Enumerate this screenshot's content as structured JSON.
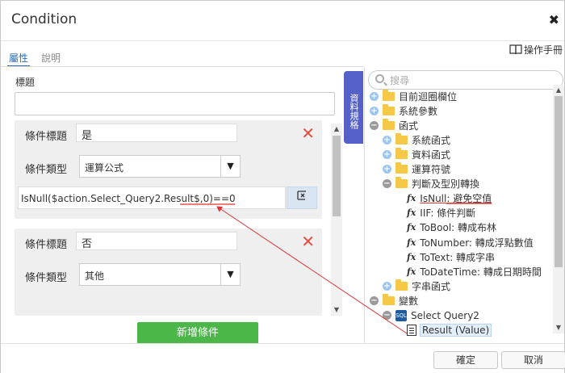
{
  "window": {
    "title": "Condition",
    "close": "✖"
  },
  "manual": {
    "label": "操作手冊"
  },
  "tabs": [
    {
      "label": "屬性",
      "active": true
    },
    {
      "label": "說明",
      "active": false
    }
  ],
  "left": {
    "title_label": "標題",
    "title_value": "",
    "conditions": [
      {
        "title_label": "條件標題",
        "title_value": "是",
        "type_label": "條件類型",
        "type_value": "運算公式",
        "formula": "IsNull($action.Select_Query2.Result$,0)==0",
        "formula_btn_icon": "function-editor-icon"
      },
      {
        "title_label": "條件標題",
        "title_value": "否",
        "type_label": "條件類型",
        "type_value": "其他"
      }
    ],
    "add_button": "新增條件"
  },
  "side_tab": {
    "label": "資料規格"
  },
  "search": {
    "placeholder": "搜尋"
  },
  "tree": [
    {
      "label": "目前迴圈欄位",
      "toggle": "+",
      "icon": "folder",
      "depth": 0
    },
    {
      "label": "系統參數",
      "toggle": "+",
      "icon": "folder",
      "depth": 0
    },
    {
      "label": "函式",
      "toggle": "−",
      "icon": "folder",
      "depth": 0
    },
    {
      "label": "系統函式",
      "toggle": "+",
      "icon": "folder",
      "depth": 1
    },
    {
      "label": "資料函式",
      "toggle": "+",
      "icon": "folder",
      "depth": 1
    },
    {
      "label": "運算符號",
      "toggle": "+",
      "icon": "folder",
      "depth": 1
    },
    {
      "label": "判斷及型別轉換",
      "toggle": "−",
      "icon": "folder",
      "depth": 1
    },
    {
      "label": "IsNull: 避免空值",
      "toggle": "",
      "icon": "fx",
      "depth": 2,
      "highlight": true
    },
    {
      "label": "IIF: 條件判斷",
      "toggle": "",
      "icon": "fx",
      "depth": 2
    },
    {
      "label": "ToBool: 轉成布林",
      "toggle": "",
      "icon": "fx",
      "depth": 2
    },
    {
      "label": "ToNumber: 轉成浮點數值",
      "toggle": "",
      "icon": "fx",
      "depth": 2
    },
    {
      "label": "ToText: 轉成字串",
      "toggle": "",
      "icon": "fx",
      "depth": 2
    },
    {
      "label": "ToDateTime: 轉成日期時間",
      "toggle": "",
      "icon": "fx",
      "depth": 2
    },
    {
      "label": "字串函式",
      "toggle": "+",
      "icon": "folder",
      "depth": 1
    },
    {
      "label": "變數",
      "toggle": "−",
      "icon": "folder",
      "depth": 0
    },
    {
      "label": "Select Query2",
      "toggle": "−",
      "icon": "db",
      "depth": 1
    },
    {
      "label": "Result (Value)",
      "toggle": "",
      "icon": "doc",
      "depth": 2,
      "selected": true
    }
  ],
  "footer": {
    "ok": "確定",
    "cancel": "取消"
  },
  "colors": {
    "accent": "#2a6fb5",
    "add_button": "#4bb749",
    "delete": "#e05040",
    "side_tab": "#5560c9",
    "arrow": "#d33"
  }
}
